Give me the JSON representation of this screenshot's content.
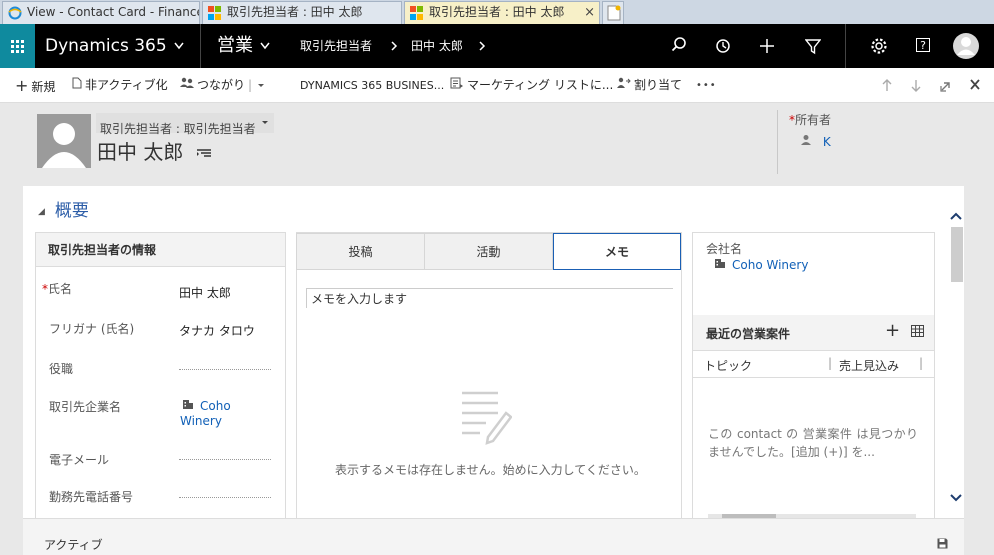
{
  "browser": {
    "tabs": [
      {
        "label": "View - Contact Card - Finance ...",
        "favicon": "ie-icon"
      },
      {
        "label": "取引先担当者 : 田中 太郎",
        "favicon": "dynamics-icon"
      },
      {
        "label": "取引先担当者 : 田中 太郎",
        "favicon": "dynamics-icon",
        "active": true
      }
    ],
    "close": "×"
  },
  "nav": {
    "app": "Dynamics 365",
    "module": "営業",
    "breadcrumb1": "取引先担当者",
    "breadcrumb2": "田中 太郎",
    "help": "?"
  },
  "commands": {
    "new": "新規",
    "deactivate": "非アクティブ化",
    "connect": "つながり",
    "d365": "DYNAMICS 365 BUSINES...",
    "marketing": "マーケティング リストに...",
    "assign": "割り当て",
    "more": "•••"
  },
  "header": {
    "form_selector": "取引先担当者 : 取引先担当者",
    "name": "田中 太郎",
    "owner_label": "所有者",
    "owner_value": "K"
  },
  "section": {
    "title": "概要"
  },
  "contact_info": {
    "title": "取引先担当者の情報",
    "fields": [
      {
        "label": "氏名",
        "value": "田中 太郎",
        "required": true
      },
      {
        "label": "フリガナ (氏名)",
        "value": "タナカ タロウ"
      },
      {
        "label": "役職",
        "value": ""
      },
      {
        "label": "取引先企業名",
        "value": "Coho Winery"
      },
      {
        "label": "電子メール",
        "value": ""
      },
      {
        "label": "勤務先電話番号",
        "value": ""
      }
    ]
  },
  "activity": {
    "tabs": [
      "投稿",
      "活動",
      "メモ"
    ],
    "active_tab": 2,
    "note_placeholder": "メモを入力します",
    "empty_message": "表示するメモは存在しません。始めに入力してください。"
  },
  "company": {
    "label": "会社名",
    "value": "Coho Winery"
  },
  "opportunities": {
    "title": "最近の営業案件",
    "columns": [
      "トピック",
      "売上見込み"
    ],
    "empty_message": "この contact の 営業案件 は見つかりませんでした。[追加 (+)] を..."
  },
  "footer": {
    "status": "アクティブ"
  }
}
